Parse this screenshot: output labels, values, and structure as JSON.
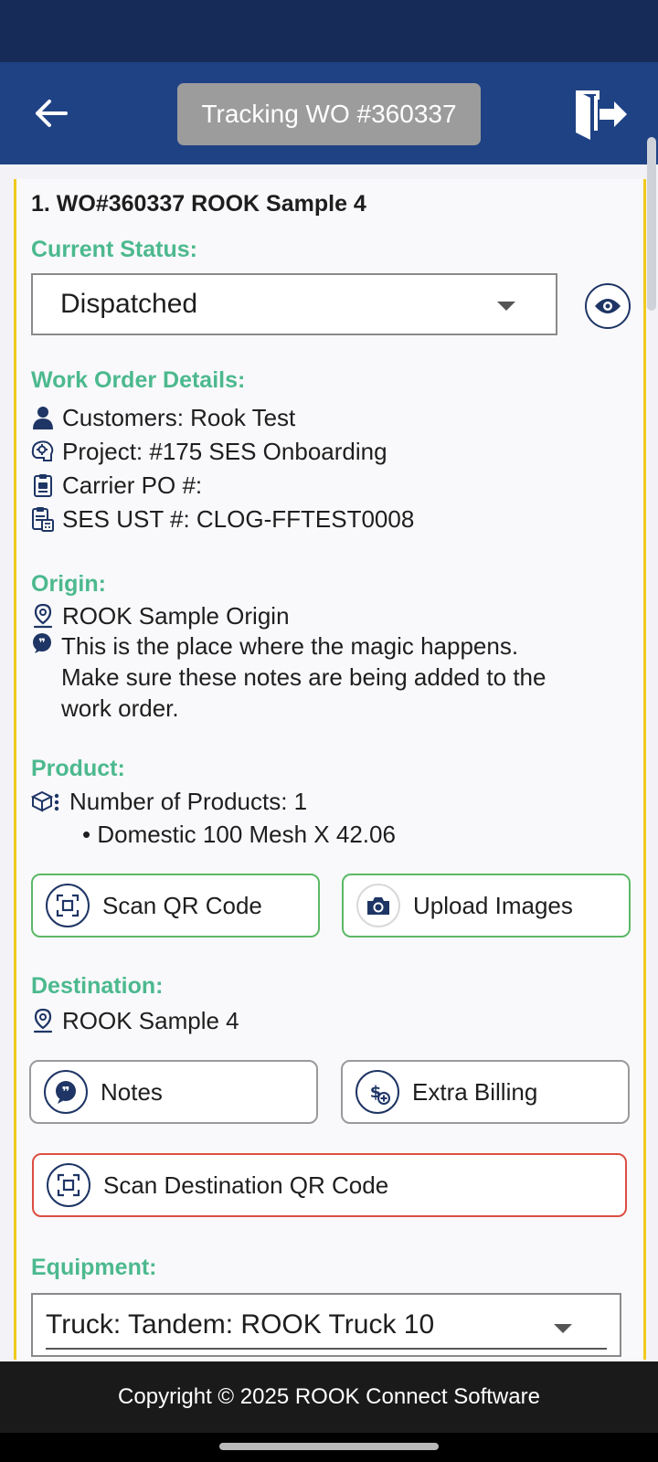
{
  "header": {
    "title": "Tracking WO #360337",
    "back_icon": "arrow-left-icon",
    "logout_icon": "logout-door-icon",
    "bar_color": "#1f4284",
    "status_bar_color": "#162b58"
  },
  "work_order": {
    "heading": "1. WO#360337 ROOK Sample 4",
    "accent_border": "#f1c91c"
  },
  "status": {
    "label": "Current Status:",
    "value": "Dispatched"
  },
  "details": {
    "label": "Work Order Details:",
    "customers": "Customers: Rook Test",
    "project": "Project: #175 SES Onboarding",
    "carrier_po": "Carrier PO #:",
    "ses_ust": "SES UST #: CLOG-FFTEST0008"
  },
  "origin": {
    "label": "Origin:",
    "name": "ROOK Sample Origin",
    "notes_line1": "This is the place where the magic happens.",
    "notes_line2": "Make sure these notes are being added to the",
    "notes_line3": "work order."
  },
  "product": {
    "label": "Product:",
    "count": "Number of Products: 1",
    "item": "• Domestic 100 Mesh X 42.06"
  },
  "buttons": {
    "scan_qr": "Scan QR Code",
    "upload_images": "Upload Images",
    "notes": "Notes",
    "extra_billing": "Extra Billing",
    "scan_destination_qr": "Scan Destination QR Code"
  },
  "destination": {
    "label": "Destination:",
    "name": "ROOK Sample 4"
  },
  "equipment": {
    "label": "Equipment:",
    "value": "Truck: Tandem: ROOK Truck 10"
  },
  "footer": {
    "copyright": "Copyright © 2025 ROOK Connect Software"
  },
  "colors": {
    "section_label": "#4cb98e",
    "green_button_border": "#5cb866",
    "red_button_border": "#dc4f42",
    "icon_navy": "#1e3565"
  }
}
